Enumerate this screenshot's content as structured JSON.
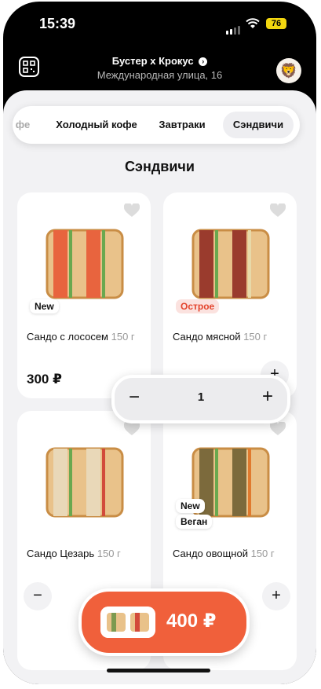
{
  "status_bar": {
    "time": "15:39",
    "battery": "76"
  },
  "header": {
    "store_name": "Бустер х Крокус",
    "address": "Международная улица, 16"
  },
  "tabs": [
    {
      "label": "фе"
    },
    {
      "label": "Холодный кофе"
    },
    {
      "label": "Завтраки"
    },
    {
      "label": "Сэндвичи",
      "active": true
    }
  ],
  "section_title": "Сэндвичи",
  "products": [
    {
      "name": "Сандо с лососем",
      "weight": "150 г",
      "price": "300 ₽",
      "badges": [
        "New"
      ],
      "fill_color": "#e8643e"
    },
    {
      "name": "Сандо мясной",
      "weight": "150 г",
      "badges": [
        "Острое"
      ],
      "fill_color": "#9a3b2d"
    },
    {
      "name": "Сандо Цезарь",
      "weight": "150 г",
      "badges": [],
      "fill_color": "#e9d8b8"
    },
    {
      "name": "Сандо овощной",
      "weight": "150 г",
      "badges": [
        "New",
        "Веган"
      ],
      "fill_color": "#7c6a3c"
    }
  ],
  "stepper": {
    "minus": "−",
    "quantity": "1",
    "plus": "+"
  },
  "card_buttons": {
    "minus": "−",
    "plus": "+"
  },
  "cart": {
    "total": "400 ₽"
  },
  "colors": {
    "accent": "#f0603b",
    "spicy": "#e3442c",
    "background": "#f2f2f4"
  }
}
